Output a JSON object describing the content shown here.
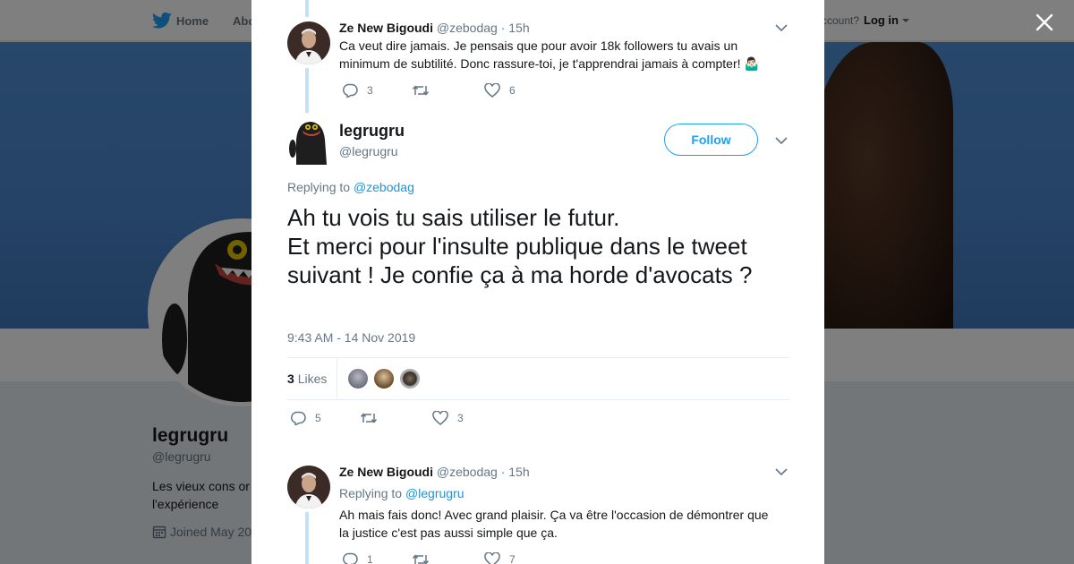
{
  "nav": {
    "home_label": "Home",
    "about_label": "Abo",
    "account_prompt": "ccount?",
    "login_label": "Log in"
  },
  "profile": {
    "name": "legrugru",
    "handle": "@legrugru",
    "bio_line1": "Les vieux cons or",
    "bio_line2": "l'expérience",
    "joined": "Joined May 20"
  },
  "thread": {
    "reply_above": {
      "author_name": "Ze New Bigoudi",
      "author_handle": "@zebodag",
      "time": "· 15h",
      "text": "Ca veut dire jamais. Je pensais que pour avoir 18k followers tu avais un minimum de subtilité. Donc rassure-toi, je t'apprendrai jamais à compter! 🤷🏻‍♂️",
      "replies": "3",
      "retweets": "",
      "likes": "6"
    },
    "main_tweet": {
      "author_name": "legrugru",
      "author_handle": "@legrugru",
      "follow_label": "Follow",
      "replying_prefix": "Replying to",
      "replying_to": "@zebodag",
      "text": "Ah tu vois tu sais utiliser le futur.\nEt merci pour l'insulte publique dans le tweet suivant ! Je confie ça à ma horde d'avocats ?",
      "timestamp": "9:43 AM - 14 Nov 2019",
      "likes_count": "3",
      "likes_label": "Likes",
      "replies": "5",
      "retweets": "",
      "likes": "3"
    },
    "reply_below": {
      "author_name": "Ze New Bigoudi",
      "author_handle": "@zebodag",
      "time": "· 15h",
      "replying_prefix": "Replying to",
      "replying_to": "@legrugru",
      "text": "Ah mais fais donc! Avec grand plaisir. Ça va être l'occasion de démontrer que la justice c'est pas aussi simple que ça.",
      "replies": "1",
      "retweets": "",
      "likes": "7"
    }
  },
  "colors": {
    "accent": "#1da1f2",
    "link": "#1b95e0",
    "muted": "#657786",
    "thread_line": "#c4e1f5"
  },
  "icons": [
    "twitter-bird-icon",
    "close-icon",
    "chevron-down-icon",
    "reply-icon",
    "retweet-icon",
    "heart-icon",
    "calendar-icon"
  ]
}
